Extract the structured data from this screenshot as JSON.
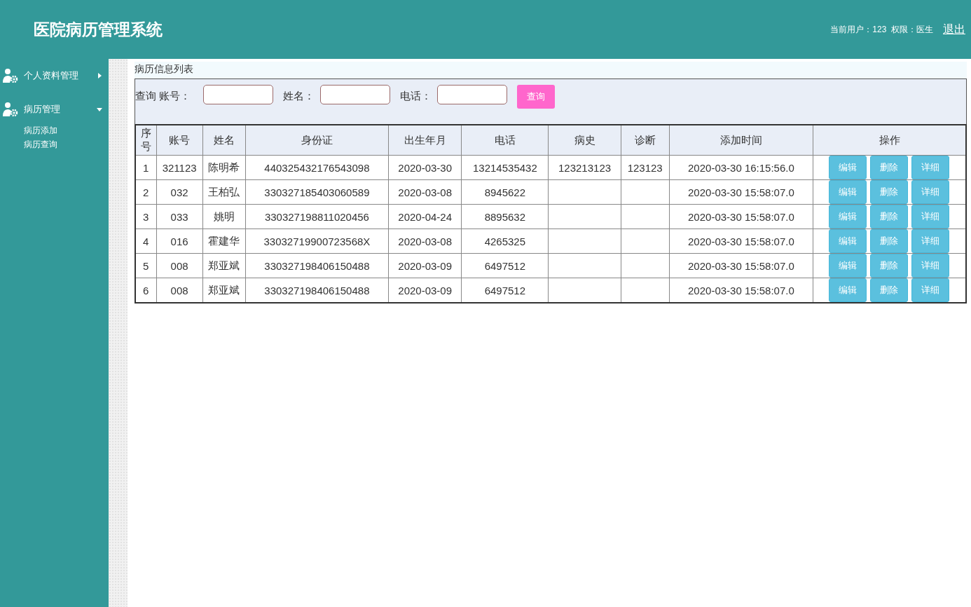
{
  "header": {
    "title": "医院病历管理系统",
    "user_info": "当前用户：123  权限：医生",
    "logout": "退出"
  },
  "sidebar": {
    "groups": [
      {
        "label": "个人资料管理",
        "expanded": false
      },
      {
        "label": "病历管理",
        "expanded": true,
        "children": [
          {
            "label": "病历添加"
          },
          {
            "label": "病历查询"
          }
        ]
      }
    ]
  },
  "panel_title": "病历信息列表",
  "search": {
    "label": "查询",
    "fields": [
      {
        "label": "账号："
      },
      {
        "label": "姓名："
      },
      {
        "label": "电话："
      }
    ],
    "button": "查询"
  },
  "table": {
    "columns": [
      "序号",
      "账号",
      "姓名",
      "身份证",
      "出生年月",
      "电话",
      "病史",
      "诊断",
      "添加时间",
      "操作"
    ],
    "rows": [
      {
        "index": "1",
        "account": "321123",
        "name": "陈明希",
        "id_card": "440325432176543098",
        "birth": "2020-03-30",
        "phone": "13214535432",
        "history": "123213123",
        "diagnosis": "123123",
        "added": "2020-03-30 16:15:56.0",
        "actions": [
          "编辑",
          "删除",
          "详细"
        ]
      },
      {
        "index": "2",
        "account": "032",
        "name": "王柏弘",
        "id_card": "330327185403060589",
        "birth": "2020-03-08",
        "phone": "8945622",
        "added": "2020-03-30 15:58:07.0",
        "actions": [
          "编辑",
          "删除",
          "详细"
        ]
      },
      {
        "index": "3",
        "account": "033",
        "name": "姚明",
        "id_card": "330327198811020456",
        "birth": "2020-04-24",
        "phone": "8895632",
        "added": "2020-03-30 15:58:07.0",
        "actions": [
          "编辑",
          "删除",
          "详细"
        ]
      },
      {
        "index": "4",
        "account": "016",
        "name": "霍建华",
        "id_card": "33032719900723568X",
        "birth": "2020-03-08",
        "phone": "4265325",
        "added": "2020-03-30 15:58:07.0",
        "actions": [
          "编辑",
          "删除",
          "详细"
        ]
      },
      {
        "index": "5",
        "account": "008",
        "name": "郑亚斌",
        "id_card": "330327198406150488",
        "birth": "2020-03-09",
        "phone": "6497512",
        "added": "2020-03-30 15:58:07.0",
        "actions": [
          "编辑",
          "删除",
          "详细"
        ]
      },
      {
        "index": "6",
        "account": "008",
        "name": "郑亚斌",
        "id_card": "330327198406150488",
        "birth": "2020-03-09",
        "phone": "6497512",
        "added": "2020-03-30 15:58:07.0",
        "actions": [
          "编辑",
          "删除",
          "详细"
        ]
      }
    ]
  }
}
